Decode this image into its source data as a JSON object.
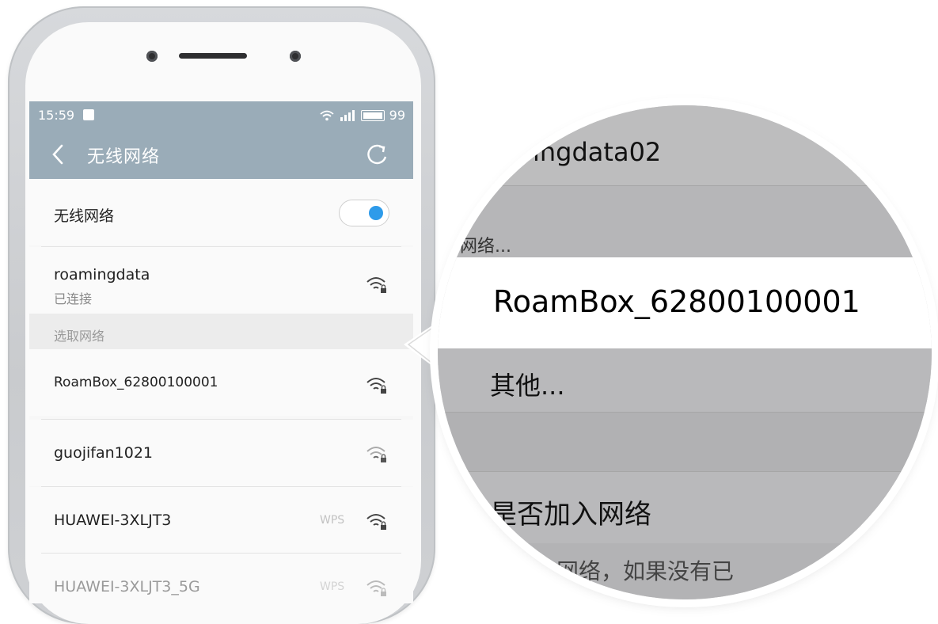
{
  "status_bar": {
    "time": "15:59",
    "battery": "99"
  },
  "title_bar": {
    "title": "无线网络"
  },
  "wifi_toggle": {
    "label": "无线网络",
    "state": "on"
  },
  "connected_network": {
    "name": "roamingdata",
    "status": "已连接"
  },
  "section": {
    "header": "选取网络"
  },
  "networks": [
    {
      "name": "RoamBox_62800100001",
      "wps": ""
    },
    {
      "name": "guojifan1021",
      "wps": ""
    },
    {
      "name": "HUAWEI-3XLJT3",
      "wps": "WPS"
    },
    {
      "name": "HUAWEI-3XLJT3_5G",
      "wps": "WPS"
    }
  ],
  "zoom": {
    "row_top": "ingdata02",
    "row_other_partial": "网络...",
    "highlight": "RoamBox_62800100001",
    "other": "其他...",
    "join_prompt": "是否加入网络",
    "bottom_partial": "网络，如果没有已"
  },
  "colors": {
    "header": "#9aacb8",
    "accent": "#2e9bea",
    "zoom_gray": "#b9b9bb"
  }
}
